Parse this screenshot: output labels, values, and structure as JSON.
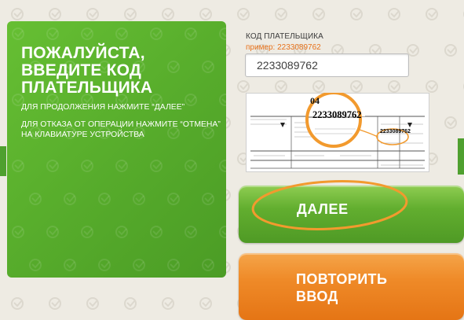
{
  "panel": {
    "title_line1": "ПОЖАЛУЙСТА,",
    "title_line2": "ВВЕДИТЕ КОД",
    "title_line3": "ПЛАТЕЛЬЩИКА",
    "instruction_next": "ДЛЯ ПРОДОЛЖЕНИЯ НАЖМИТЕ “ДАЛЕЕ”",
    "instruction_cancel": "ДЛЯ ОТКАЗА ОТ ОПЕРАЦИИ НАЖМИТЕ “ОТМЕНА” НА КЛАВИАТУРЕ УСТРОЙСТВА"
  },
  "payer_code": {
    "label": "КОД ПЛАТЕЛЬЩИКА",
    "example": "пример: 2233089762",
    "value": "2233089762"
  },
  "receipt": {
    "code_fragment": "04",
    "code_highlight": "2233089762",
    "code_small": "2233089762"
  },
  "buttons": {
    "next_label": "ДАЛЕЕ",
    "retry_label": "ПОВТОРИТЬ ВВОД"
  },
  "colors": {
    "brand_green": "#59b02c",
    "accent_orange": "#ef8a28",
    "example_text": "#e7711a",
    "background": "#eeebe3"
  }
}
